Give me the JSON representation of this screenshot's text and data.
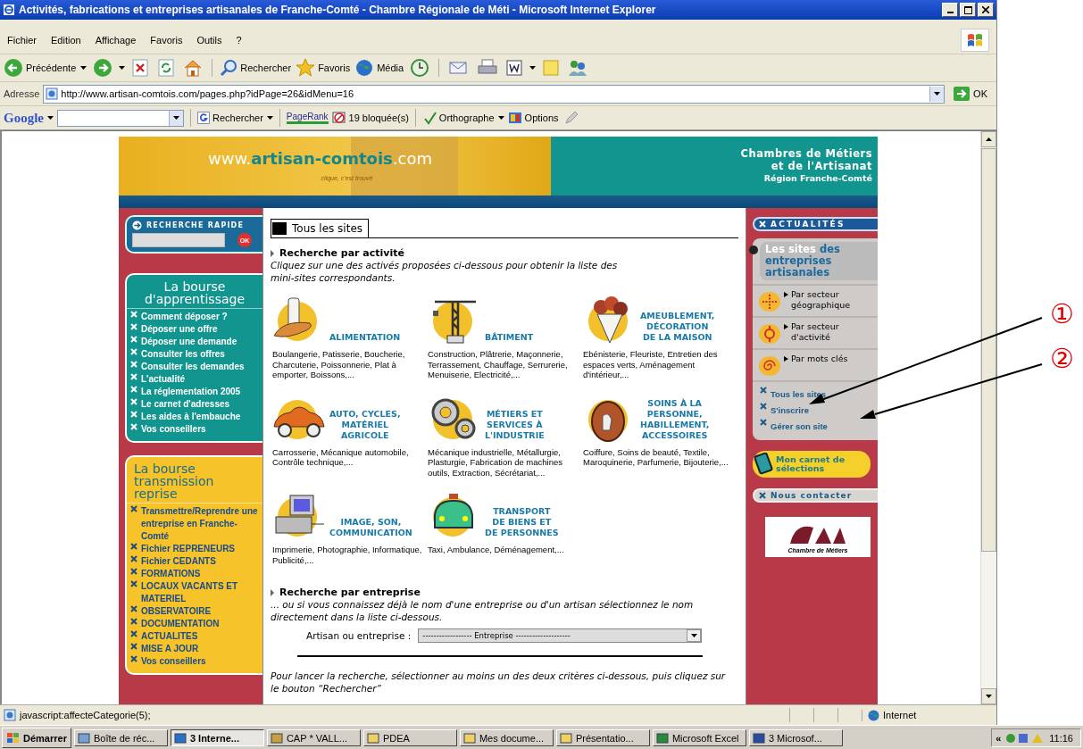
{
  "window": {
    "title": "Activités, fabrications et entreprises artisanales de Franche-Comté - Chambre Régionale de Méti - Microsoft Internet Explorer"
  },
  "menu": [
    "Fichier",
    "Edition",
    "Affichage",
    "Favoris",
    "Outils",
    "?"
  ],
  "toolbar": {
    "back": "Précédente",
    "search": "Rechercher",
    "favorites": "Favoris",
    "media": "Média"
  },
  "address": {
    "label": "Adresse",
    "url": "http://www.artisan-comtois.com/pages.php?idPage=26&idMenu=16",
    "go": "OK"
  },
  "google_bar": {
    "logo": "Google",
    "search": "Rechercher",
    "pagerank": "PageRank",
    "blocked": "19 bloquée(s)",
    "spelling": "Orthographe",
    "options": "Options"
  },
  "banner": {
    "prefix": "www.",
    "name": "artisan-comtois",
    "suffix": ".com",
    "slogan": "clique, c'est trouvé",
    "org": [
      "Chambres de Métiers",
      "et de l'Artisanat",
      "Région Franche-Comté"
    ]
  },
  "quick_search": {
    "title": "RECHERCHE RAPIDE",
    "button": "OK"
  },
  "apprentissage": {
    "title": [
      "La bourse",
      "d'apprentissage"
    ],
    "links": [
      "Comment déposer ?",
      "Déposer une offre",
      "Déposer une demande",
      "Consulter les offres",
      "Consulter les demandes",
      "L'actualité",
      "La réglementation 2005",
      "Le carnet d'adresses",
      "Les aides à l'embauche",
      "Vos conseillers"
    ]
  },
  "transmission": {
    "title": [
      "La bourse",
      "transmission",
      "reprise"
    ],
    "links": [
      "Transmettre/Reprendre une entreprise en Franche-Comté",
      "Fichier REPRENEURS",
      "Fichier CEDANTS",
      "FORMATIONS",
      "LOCAUX VACANTS ET MATERIEL",
      "OBSERVATOIRE",
      "DOCUMENTATION",
      "ACTUALITES",
      "MISE A JOUR",
      "Vos conseillers"
    ]
  },
  "heading": "Tous les sites",
  "activity": {
    "title": "Recherche par activité",
    "intro": "Cliquez sur une des activés proposées ci-dessous pour obtenir la liste des mini-sites correspondants."
  },
  "categories": [
    {
      "name": "ALIMENTATION",
      "description": "Boulangerie, Patisserie, Boucherie, Charcuterie, Poissonnerie, Plat à emporter, Boissons,..."
    },
    {
      "name": "BÂTIMENT",
      "description": "Construction, Plâtrerie, Maçonnerie, Terrassement, Chauffage, Serrurerie, Menuiserie, Electricité,..."
    },
    {
      "name": "AMEUBLEMENT,\nDÉCORATION\nDE LA MAISON",
      "description": "Ebénisterie, Fleuriste, Entretien des espaces verts, Aménagement d'intérieur,..."
    },
    {
      "name": "AUTO, CYCLES,\nMATÉRIEL\nAGRICOLE",
      "description": "Carrosserie, Mécanique automobile, Contrôle technique,..."
    },
    {
      "name": "MÉTIERS ET\nSERVICES À\nL'INDUSTRIE",
      "description": "Mécanique industrielle, Métallurgie, Plasturgie, Fabrication de machines outils, Extraction, Sécrétariat,..."
    },
    {
      "name": "SOINS À LA\nPERSONNE,\nHABILLEMENT,\nACCESSOIRES",
      "description": "Coiffure, Soins de beauté, Textile, Maroquinerie, Parfumerie, Bijouterie,..."
    },
    {
      "name": "IMAGE, SON,\nCOMMUNICATION",
      "description": "Imprimerie, Photographie, Informatique, Publicité,..."
    },
    {
      "name": "TRANSPORT\nDE BIENS ET\nDE PERSONNES",
      "description": "Taxi, Ambulance, Déménagement,..."
    }
  ],
  "company": {
    "title": "Recherche par entreprise",
    "intro": "... ou si vous connaissez déjà le nom d'une entreprise ou d'un artisan sélectionnez le nom directement dans la liste ci-dessous.",
    "label": "Artisan ou entreprise :",
    "select": "------------------ Entreprise --------------------",
    "note": "Pour lancer la recherche, sélectionner au moins un des deux critères ci-dessous, puis cliquez sur le bouton “Rechercher”"
  },
  "right": {
    "news": "ACTUALITÉS",
    "sites_title": "Les sites",
    "sites_subtitle": "des entreprises artisanales",
    "options": [
      "Par secteur géographique",
      "Par secteur d'activité",
      "Par mots clés"
    ],
    "links": [
      "Tous les sites",
      "S'inscrire",
      "Gérer son site"
    ],
    "basket": "Mon carnet de sélections",
    "contact": "Nous contacter",
    "logo_caption": "Chambre de Métiers"
  },
  "annotations": [
    "①",
    "②"
  ],
  "status_bar": {
    "text": "javascript:affecteCategorie(5);",
    "zone": "Internet"
  },
  "taskbar": {
    "start": "Démarrer",
    "items": [
      {
        "label": "Boîte de réc...",
        "selected": false
      },
      {
        "label": "3 Interne...",
        "selected": true
      },
      {
        "label": "CAP * VALL...",
        "selected": false
      },
      {
        "label": "PDEA",
        "selected": false
      },
      {
        "label": "Mes docume...",
        "selected": false
      },
      {
        "label": "Présentatio...",
        "selected": false
      },
      {
        "label": "Microsoft Excel",
        "selected": false
      },
      {
        "label": "3 Microsof...",
        "selected": false
      }
    ],
    "tray": "«",
    "clock": "11:16"
  }
}
